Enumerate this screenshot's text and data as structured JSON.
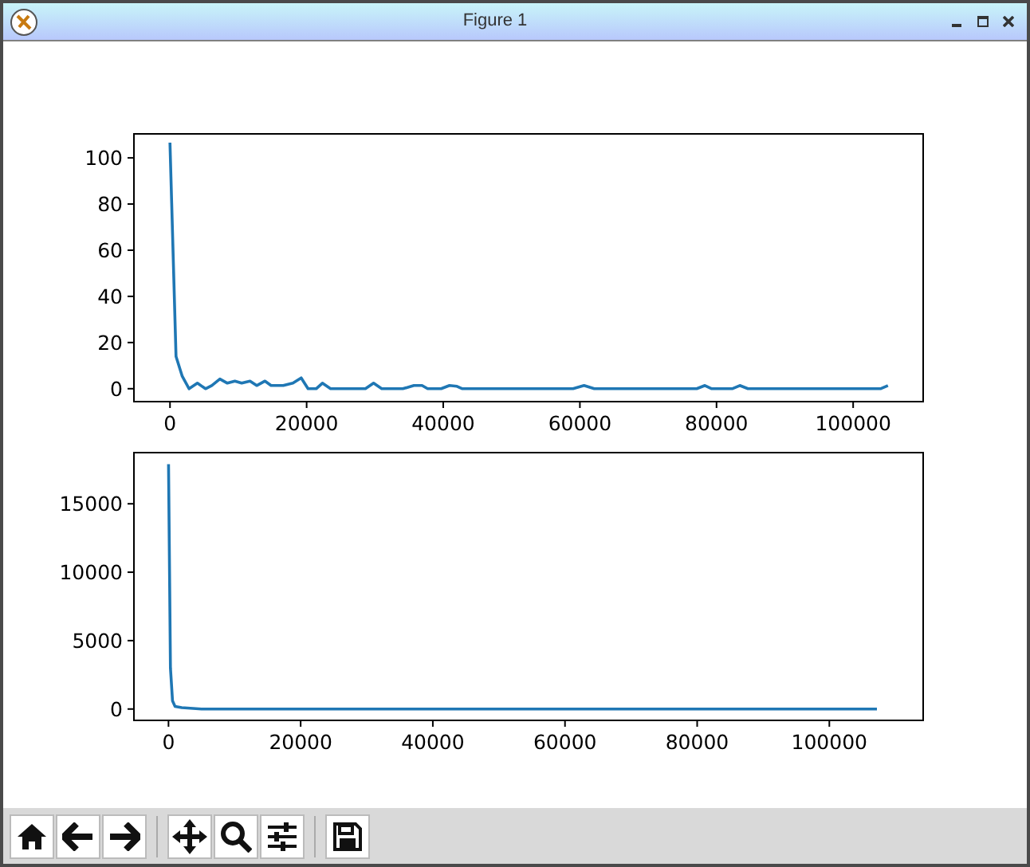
{
  "window": {
    "title": "Figure 1"
  },
  "figure": {
    "charts": [
      {
        "chart_data": {
          "type": "line",
          "xlim": [
            -5280,
            110250
          ],
          "ylim": [
            -5.6,
            110.4
          ],
          "xticks": [
            0,
            20000,
            40000,
            60000,
            80000,
            100000
          ],
          "yticks": [
            0,
            20,
            40,
            60,
            80,
            100
          ],
          "series": [
            {
              "color": "#1f77b4",
              "x": [
                0,
                870,
                1800,
                2800,
                4000,
                5200,
                6100,
                7300,
                8400,
                9500,
                10500,
                11700,
                12700,
                13900,
                14800,
                16600,
                18000,
                19200,
                20200,
                21400,
                22300,
                23500,
                28600,
                29800,
                31000,
                34100,
                35700,
                36900,
                37700,
                39700,
                40900,
                42000,
                42800,
                59000,
                60600,
                62100,
                77100,
                78300,
                79300,
                82300,
                83400,
                84600,
                104000,
                105100
              ],
              "values": [
                106.6,
                14,
                5.4,
                0,
                2.4,
                0,
                1.4,
                4.2,
                2.4,
                3.3,
                2.4,
                3.3,
                1.4,
                3.3,
                1.4,
                1.4,
                2.4,
                4.7,
                0,
                0,
                2.4,
                0,
                0,
                2.4,
                0,
                0,
                1.4,
                1.4,
                0,
                0,
                1.4,
                1,
                0,
                0,
                1.4,
                0,
                0,
                1.4,
                0,
                0,
                1.4,
                0,
                0,
                1.4
              ]
            }
          ]
        }
      },
      {
        "chart_data": {
          "type": "line",
          "xlim": [
            -5230,
            114200
          ],
          "ylim": [
            -830,
            18740
          ],
          "xticks": [
            0,
            20000,
            40000,
            60000,
            80000,
            100000
          ],
          "yticks": [
            0,
            5000,
            10000,
            15000
          ],
          "series": [
            {
              "color": "#1f77b4",
              "x": [
                0,
                300,
                600,
                1000,
                2000,
                5000,
                107200
              ],
              "values": [
                17900,
                3000,
                600,
                200,
                100,
                0,
                0
              ]
            }
          ]
        }
      }
    ]
  }
}
